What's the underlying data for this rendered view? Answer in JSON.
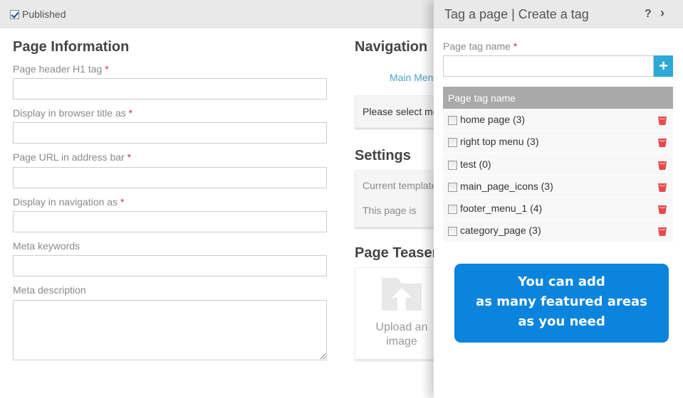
{
  "topbar": {
    "published_label": "Published",
    "published_checked": true
  },
  "page_info": {
    "title": "Page Information",
    "required_mark": "*",
    "fields": [
      {
        "label": "Page header H1 tag",
        "required": true,
        "value": ""
      },
      {
        "label": "Display in browser title as",
        "required": true,
        "value": ""
      },
      {
        "label": "Page URL in address bar",
        "required": true,
        "value": ""
      },
      {
        "label": "Display in navigation as",
        "required": true,
        "value": ""
      },
      {
        "label": "Meta keywords",
        "required": false,
        "value": ""
      },
      {
        "label": "Meta description",
        "required": false,
        "value": ""
      }
    ]
  },
  "navigation": {
    "title": "Navigation",
    "link": "Main Menu",
    "box_text": "Please select menu"
  },
  "settings": {
    "title": "Settings",
    "line1": "Current template",
    "line2": "This page is"
  },
  "teaser": {
    "title": "Page Teaser",
    "upload_line1": "Upload an",
    "upload_line2": "image",
    "icon": "upload-folder-icon"
  },
  "panel": {
    "title": "Tag a page | Create a tag",
    "help_icon": "?",
    "collapse_icon": "›",
    "input_label": "Page tag name",
    "input_value": "",
    "add_icon": "+",
    "list_header": "Page tag name",
    "tags": [
      {
        "name": "home page (3)",
        "checked": false
      },
      {
        "name": "right top menu (3)",
        "checked": false
      },
      {
        "name": "test (0)",
        "checked": false
      },
      {
        "name": "main_page_icons (3)",
        "checked": false
      },
      {
        "name": "footer_menu_1 (4)",
        "checked": false
      },
      {
        "name": "category_page (3)",
        "checked": false
      }
    ],
    "promo_lines": [
      "You can add",
      "as many featured areas",
      "as you need"
    ]
  },
  "colors": {
    "accent_blue": "#2ea8d6",
    "promo_blue": "#0a84dd",
    "delete_red": "#e8494a",
    "required_red": "#c0392b",
    "link_blue": "#4aa3c8"
  }
}
